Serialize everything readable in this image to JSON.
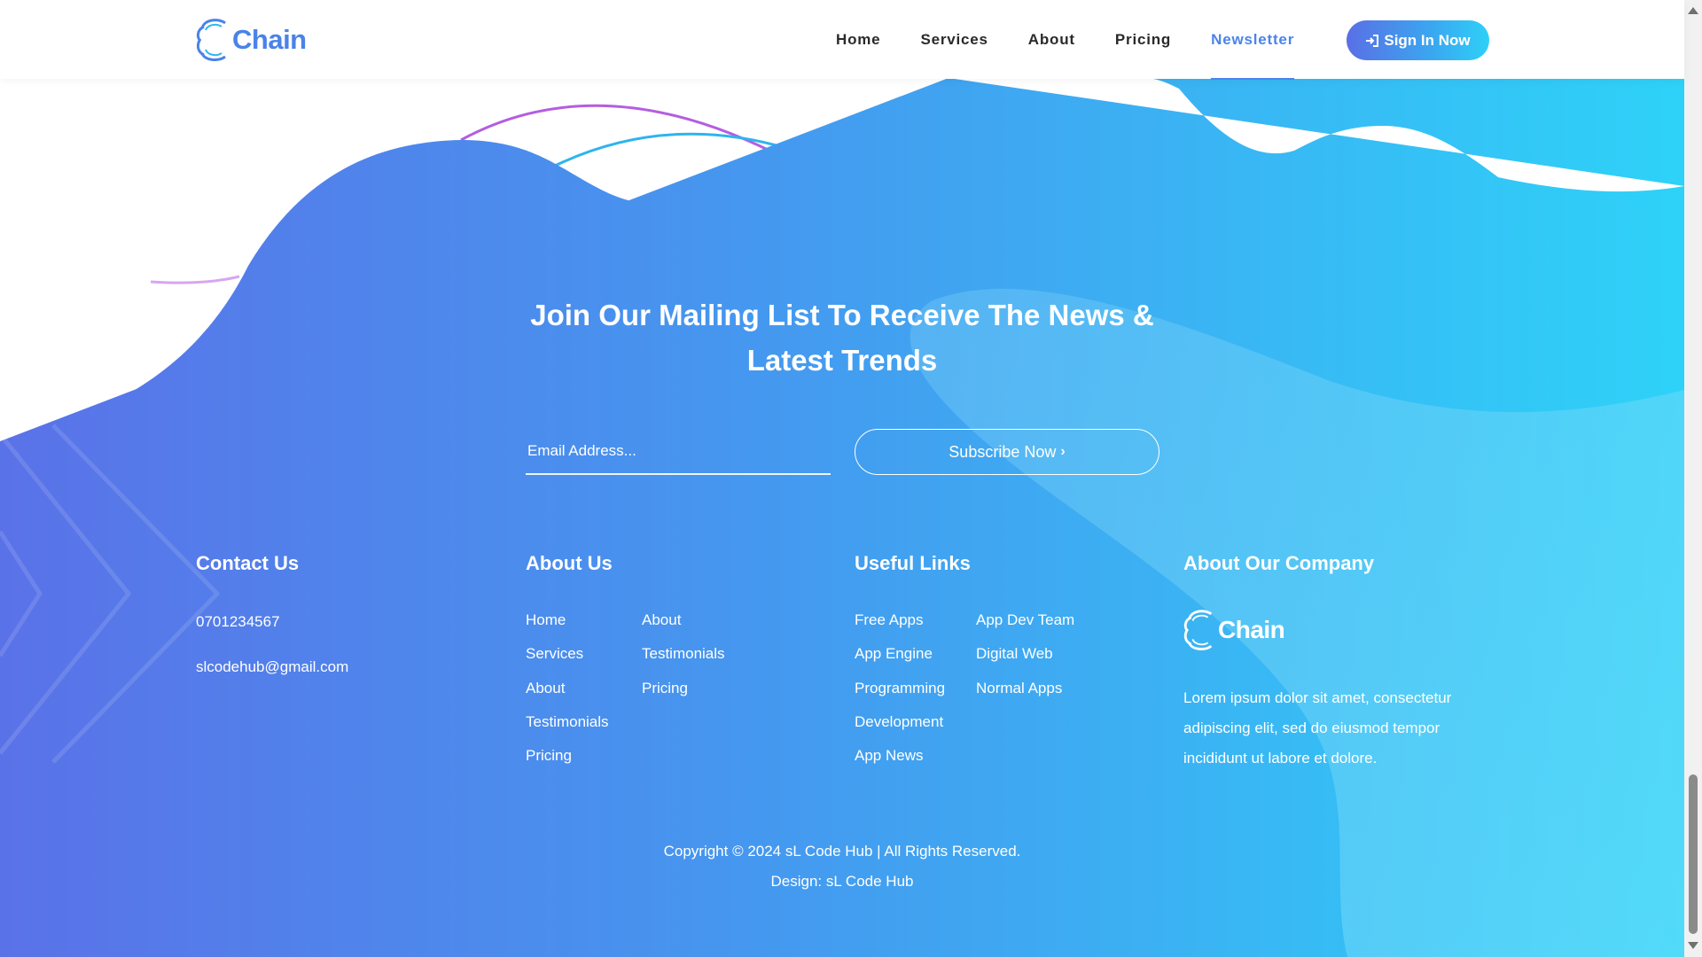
{
  "brand": {
    "name": "Chain",
    "color": "#4a83e8"
  },
  "nav": {
    "items": [
      {
        "label": "Home",
        "active": false
      },
      {
        "label": "Services",
        "active": false
      },
      {
        "label": "About",
        "active": false
      },
      {
        "label": "Pricing",
        "active": false
      },
      {
        "label": "Newsletter",
        "active": true
      }
    ],
    "signin_label": "Sign In Now"
  },
  "newsletter": {
    "title_line1": "Join Our Mailing List To Receive The News &",
    "title_line2": "Latest Trends",
    "email_placeholder": "Email Address...",
    "subscribe_label": "Subscribe Now",
    "subscribe_icon": "chevron-right-icon"
  },
  "footer": {
    "contact": {
      "title": "Contact Us",
      "phone": "0701234567",
      "email": "slcodehub@gmail.com"
    },
    "about": {
      "title": "About Us",
      "col1": [
        "Home",
        "Services",
        "About",
        "Testimonials",
        "Pricing"
      ],
      "col2": [
        "About",
        "Testimonials",
        "Pricing"
      ]
    },
    "useful": {
      "title": "Useful Links",
      "col1": [
        "Free Apps",
        "App Engine",
        "Programming",
        "Development",
        "App News"
      ],
      "col2": [
        "App Dev Team",
        "Digital Web",
        "Normal Apps"
      ]
    },
    "company": {
      "title": "About Our Company",
      "logo_text": "Chain",
      "description": "Lorem ipsum dolor sit amet, consectetur adipiscing elit, sed do eiusmod tempor incididunt ut labore et dolore."
    },
    "copyright": "Copyright © 2024 sL Code Hub | All Rights Reserved.",
    "design": "Design: sL Code Hub"
  },
  "colors": {
    "gradient_start": "#5a6fe6",
    "gradient_mid": "#4196ef",
    "gradient_end": "#2ed4f8",
    "accent": "#4a84ea"
  }
}
